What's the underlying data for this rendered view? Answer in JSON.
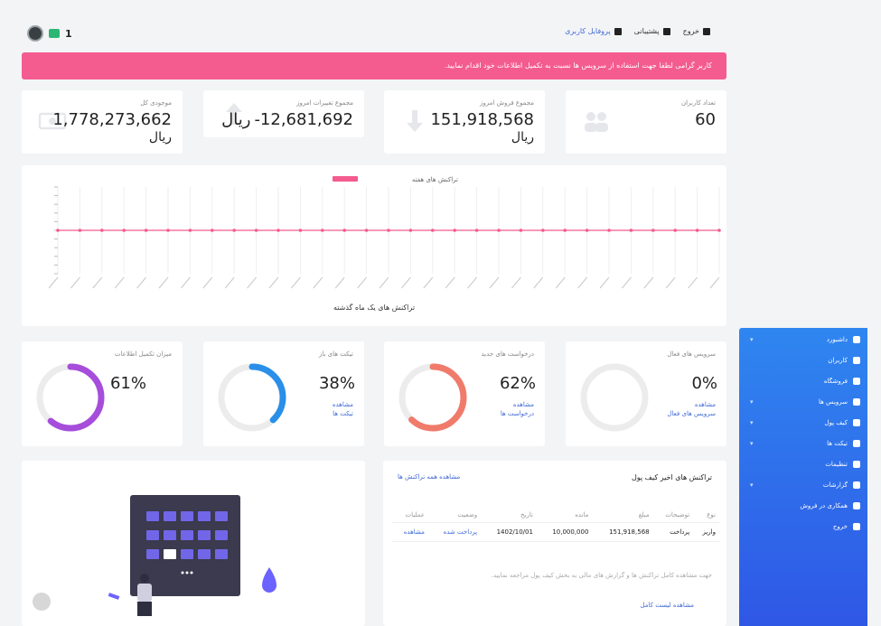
{
  "topbar": {
    "count": "1",
    "items": [
      {
        "label": "خروج",
        "icon": "logout-icon"
      },
      {
        "label": "پشتیبانی",
        "icon": "support-icon"
      },
      {
        "label": "پروفایل کاربری",
        "icon": "user-icon"
      }
    ]
  },
  "alert": {
    "text": "کاربر گرامی لطفا جهت استفاده از سرویس ها نسبت به تکمیل اطلاعات خود اقدام نمایید."
  },
  "stats": [
    {
      "title": "تعداد کاربران",
      "value": "60",
      "unit": "",
      "icon": "users-icon"
    },
    {
      "title": "مجموع فروش امروز",
      "value": "151,918,568",
      "unit": "ریال",
      "icon": "arrow-down-icon"
    },
    {
      "title": "مجموع تغییرات امروز",
      "value": "-12,681,692",
      "unit": "ریال",
      "icon": "arrow-up-icon"
    },
    {
      "title": "موجودی کل",
      "value": "1,778,273,662",
      "unit": "ریال",
      "icon": "money-icon"
    }
  ],
  "chart_data": {
    "type": "line",
    "title": "",
    "legend": "تراکنش های هفته",
    "xlabel": "تراکنش های یک ماه گذشته",
    "ylabel": "",
    "ylim": [
      -1,
      1
    ],
    "x_count": 31,
    "series": [
      {
        "name": "تراکنش های هفته",
        "values": [
          0,
          0,
          0,
          0,
          0,
          0,
          0,
          0,
          0,
          0,
          0,
          0,
          0,
          0,
          0,
          0,
          0,
          0,
          0,
          0,
          0,
          0,
          0,
          0,
          0,
          0,
          0,
          0,
          0,
          0,
          0
        ]
      }
    ]
  },
  "circles": [
    {
      "title": "سرویس های فعال",
      "pct": 0,
      "label": "0%",
      "sub1": "مشاهده",
      "sub2": "سرویس های فعال",
      "color": "#e6e6e6"
    },
    {
      "title": "درخواست های جدید",
      "pct": 62,
      "label": "62%",
      "sub1": "مشاهده",
      "sub2": "درخواست ها",
      "color": "#f07b6b"
    },
    {
      "title": "تیکت های باز",
      "pct": 38,
      "label": "38%",
      "sub1": "مشاهده",
      "sub2": "تیکت ها",
      "color": "#2a8fe8"
    },
    {
      "title": "میزان تکمیل اطلاعات",
      "pct": 61,
      "label": "61%",
      "sub1": "",
      "sub2": "",
      "color": "#a64ddb"
    }
  ],
  "transactions": {
    "title": "تراکنش های اخیر کیف پول",
    "link": "مشاهده همه تراکنش ها",
    "headers": [
      "نوع",
      "توضیحات",
      "مبلغ",
      "مانده",
      "تاریخ",
      "وضعیت",
      "عملیات"
    ],
    "row": [
      "واریز",
      "پرداخت",
      "151,918,568",
      "10,000,000",
      "1402/10/01",
      "پرداخت شده",
      "مشاهده"
    ],
    "note": "جهت مشاهده کامل تراکنش ها و گزارش های مالی به بخش کیف پول مراجعه نمایید.",
    "footer": "مشاهده لیست کامل"
  },
  "sidebar": [
    {
      "label": "داشبورد",
      "icon": "dashboard-icon",
      "chev": true
    },
    {
      "label": "کاربران",
      "icon": "user-icon",
      "chev": false
    },
    {
      "label": "فروشگاه",
      "icon": "cart-icon",
      "chev": false
    },
    {
      "label": "سرویس ها",
      "icon": "server-icon",
      "chev": true
    },
    {
      "label": "کیف پول",
      "icon": "wallet-icon",
      "chev": true
    },
    {
      "label": "تیکت ها",
      "icon": "ticket-icon",
      "chev": true
    },
    {
      "label": "تنظیمات",
      "icon": "gear-icon",
      "chev": false
    },
    {
      "label": "گزارشات",
      "icon": "report-icon",
      "chev": true
    },
    {
      "label": "همکاری در فروش",
      "icon": "share-icon",
      "chev": false
    },
    {
      "label": "خروج",
      "icon": "logout-icon",
      "chev": false
    }
  ]
}
